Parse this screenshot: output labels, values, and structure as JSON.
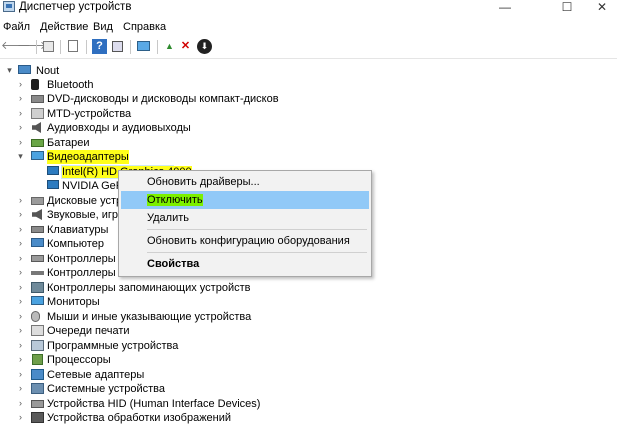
{
  "window": {
    "title": "Диспетчер устройств",
    "minimize": "—",
    "maximize": "☐",
    "close": "✕"
  },
  "menu": {
    "items": [
      "Файл",
      "Действие",
      "Вид",
      "Справка"
    ]
  },
  "toolbar": {
    "back": "🡐",
    "forward": "🡒",
    "help": "?",
    "enable": "▲",
    "uninstall": "✕",
    "update": "⬇"
  },
  "tree": {
    "root": "Nout",
    "categories": [
      "Bluetooth",
      "DVD-дисководы и дисководы компакт-дисков",
      "MTD-устройства",
      "Аудиовходы и аудиовыходы",
      "Батареи",
      "Видеоадаптеры",
      "Intel(R) HD Graphics 4000",
      "NVIDIA GeForce",
      "Дисковые устро",
      "Звуковые, игрово",
      "Клавиатуры",
      "Компьютер",
      "Контроллеры ID",
      "Контроллеры US",
      "Контроллеры запоминающих устройств",
      "Мониторы",
      "Мыши и иные указывающие устройства",
      "Очереди печати",
      "Программные устройства",
      "Процессоры",
      "Сетевые адаптеры",
      "Системные устройства",
      "Устройства HID (Human Interface Devices)",
      "Устройства обработки изображений"
    ]
  },
  "context_menu": {
    "update_driver": "Обновить драйверы...",
    "disable": "Отключить",
    "uninstall": "Удалить",
    "scan": "Обновить конфигурацию оборудования",
    "properties": "Свойства"
  },
  "colors": {
    "highlight_yellow": "#ffff1a",
    "highlight_green": "#7cf000",
    "menu_hover": "#91c9f7",
    "selection": "#cde8f7"
  }
}
